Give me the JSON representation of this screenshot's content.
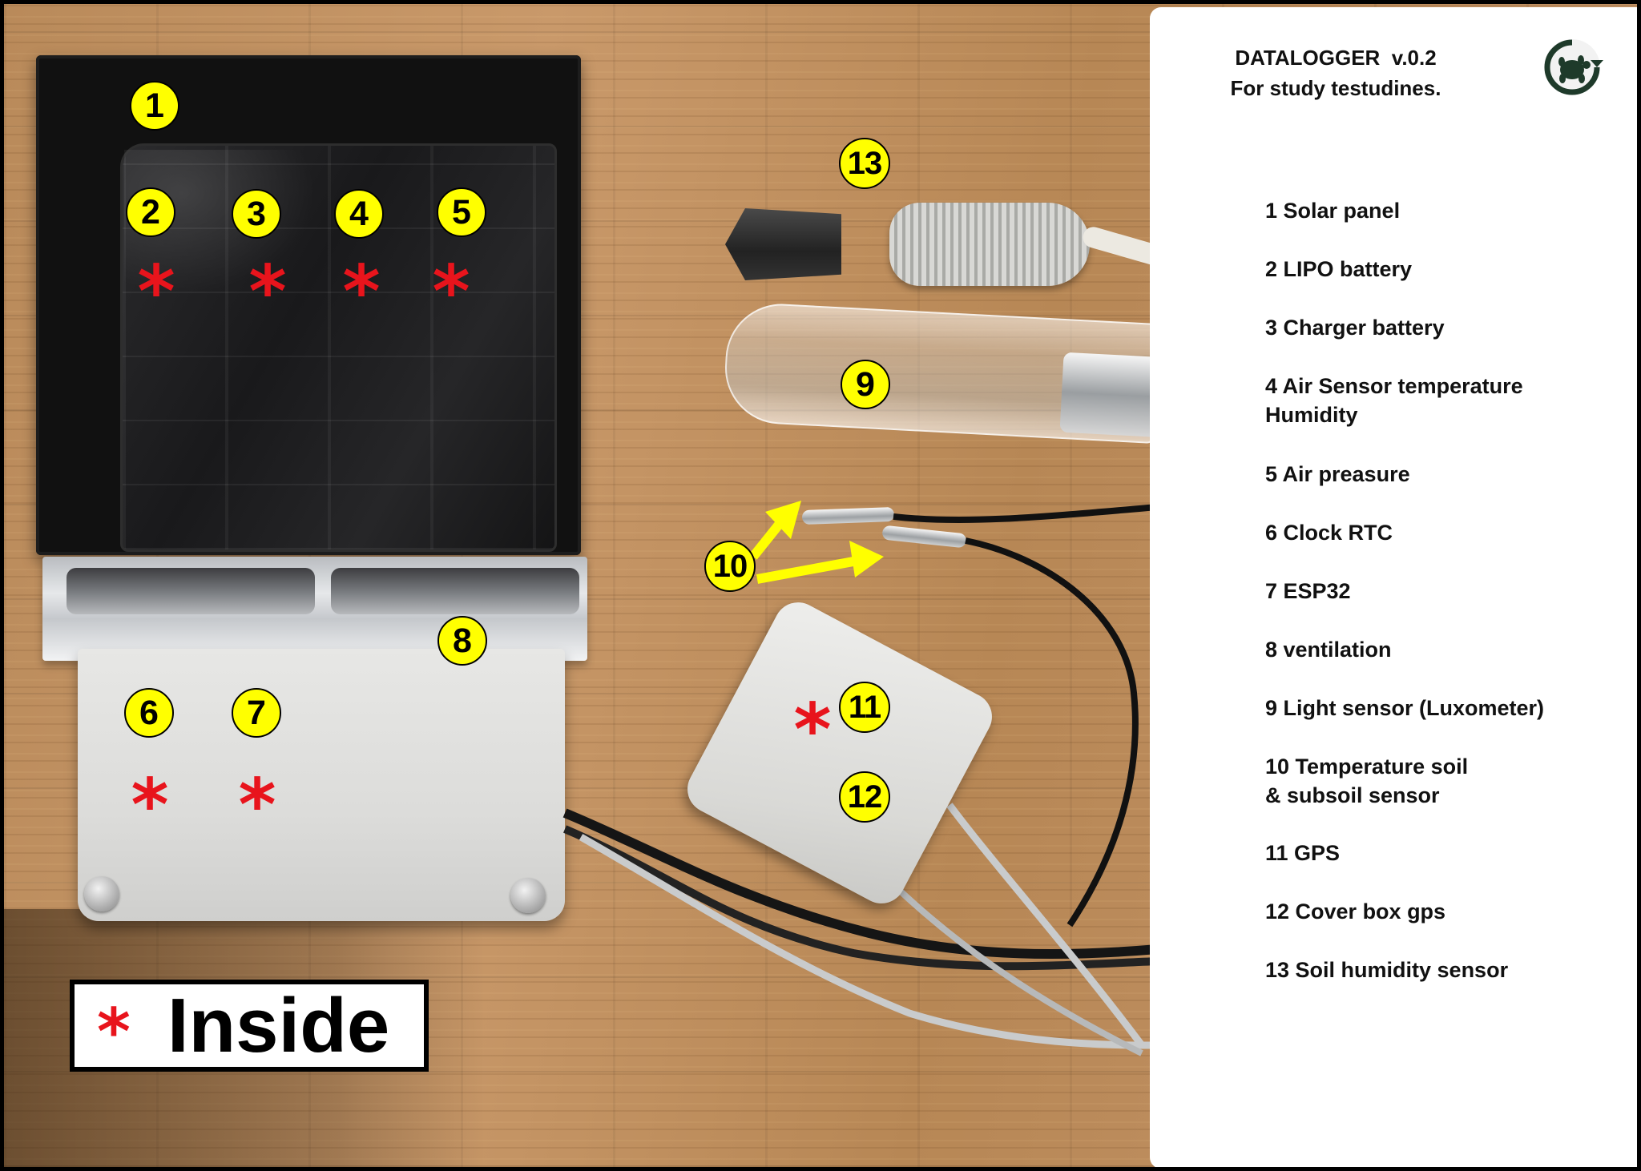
{
  "panel": {
    "title": "DATALOGGER  v.0.2",
    "subtitle": "For study testudines.",
    "logo_icon": "turtle-logo-icon",
    "legend": [
      "1 Solar panel",
      "2 LIPO battery",
      "3 Charger battery",
      "4 Air Sensor temperature\n    Humidity",
      "5 Air preasure",
      "6 Clock RTC",
      "7 ESP32",
      "8 ventilation",
      "9 Light sensor (Luxometer)",
      "10 Temperature soil\n      & subsoil sensor",
      "11 GPS",
      "12 Cover box gps",
      "13 Soil humidity sensor"
    ]
  },
  "markers": [
    "1",
    "2",
    "3",
    "4",
    "5",
    "6",
    "7",
    "8",
    "9",
    "10",
    "11",
    "12",
    "13"
  ],
  "inside_note": {
    "symbol": "*",
    "label": "Inside"
  },
  "colors": {
    "marker_fill": "#ffff00",
    "star_red": "#e8141c",
    "arrow_yellow": "#ffff00",
    "logo_green": "#1e3a2a"
  }
}
